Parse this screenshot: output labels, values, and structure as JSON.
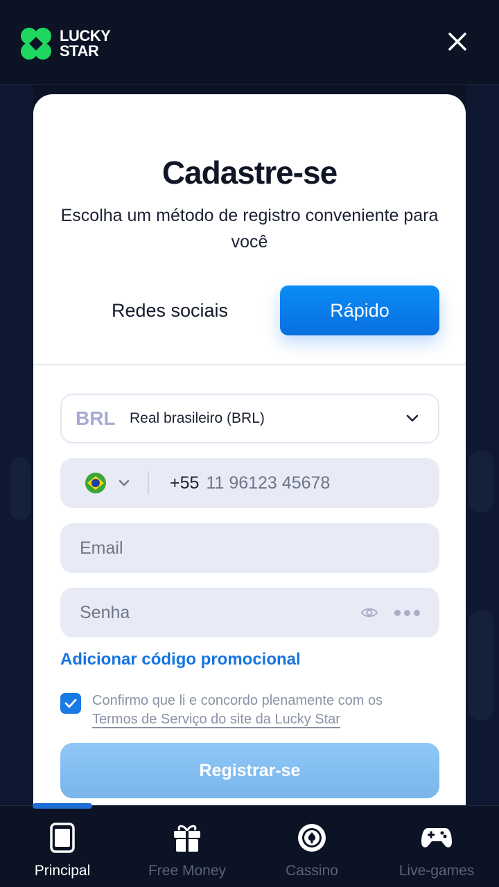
{
  "header": {
    "logo_line1": "LUCKY",
    "logo_line2": "STAR",
    "close_label": "×"
  },
  "modal": {
    "title": "Cadastre-se",
    "subtitle": "Escolha um método de registro conveniente para você",
    "tabs": [
      {
        "label": "Redes sociais",
        "active": false
      },
      {
        "label": "Rápido",
        "active": true
      }
    ],
    "currency": {
      "code": "BRL",
      "name": "Real brasileiro (BRL)"
    },
    "phone": {
      "country_flag": "brazil-flag",
      "dial_code": "+55",
      "value": "11 96123 45678"
    },
    "email": {
      "placeholder": "Email"
    },
    "password": {
      "placeholder": "Senha"
    },
    "promo_link": "Adicionar código promocional",
    "terms": {
      "checked": true,
      "text": "Confirmo que li e concordo plenamente com os",
      "link": "Termos de Serviço do site da Lucky Star"
    },
    "register_button": "Registrar-se"
  },
  "bottom_nav": {
    "items": [
      {
        "label": "Principal",
        "icon": "phone-icon",
        "active": true
      },
      {
        "label": "Free Money",
        "icon": "gift-icon",
        "active": false
      },
      {
        "label": "Cassino",
        "icon": "casino-chip-icon",
        "active": false
      },
      {
        "label": "Live-games",
        "icon": "gamepad-icon",
        "active": false
      }
    ]
  },
  "colors": {
    "background": "#0b1325",
    "accent": "#0a7cf0",
    "logo_green": "#1ed760",
    "register_button": "#86bef2"
  }
}
